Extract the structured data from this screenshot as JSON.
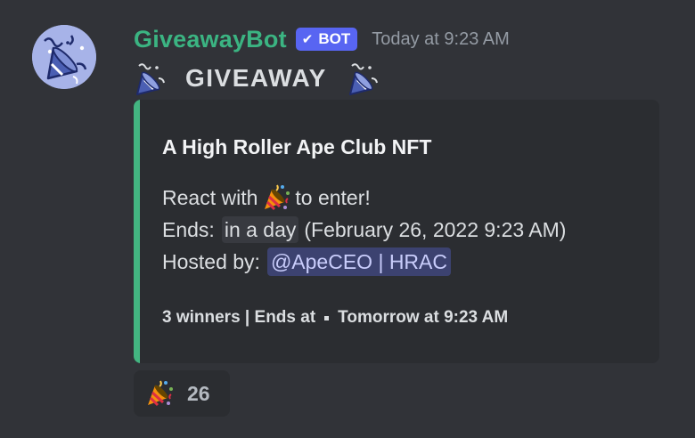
{
  "message": {
    "author": {
      "username": "GiveawayBot",
      "bot_tag": "BOT",
      "bot_check_icon": "checkmark-icon",
      "avatar_icon": "party-popper-icon"
    },
    "timestamp": "Today at 9:23 AM",
    "content_title": "GIVEAWAY",
    "title_emoji": "party-popper-icon"
  },
  "embed": {
    "accent_color": "#43b581",
    "title": "A High Roller Ape Club NFT",
    "react_prefix": "React with",
    "react_suffix": "to enter!",
    "react_emoji": "tada-icon",
    "ends_label": "Ends:",
    "ends_relative": "in a day",
    "ends_absolute": "(February 26, 2022 9:23 AM)",
    "hosted_label": "Hosted by:",
    "host_mention": "@ApeCEO | HRAC",
    "footer_winners": "3 winners | Ends at",
    "footer_time": "Tomorrow at 9:23 AM"
  },
  "reactions": [
    {
      "emoji": "tada-icon",
      "count": "26"
    }
  ],
  "colors": {
    "background": "#313338",
    "username": "#3bb482",
    "bot_tag": "#5865f2",
    "embed_bg": "#2b2d31",
    "mention_bg": "#3c4270"
  }
}
